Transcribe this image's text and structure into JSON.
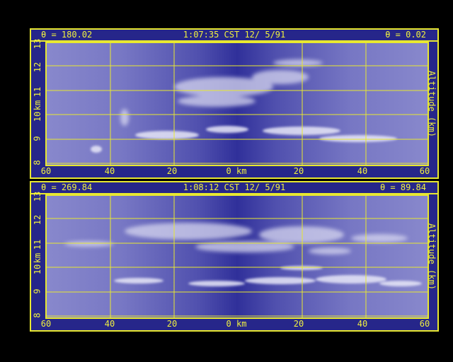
{
  "colors": {
    "background": "#000000",
    "frame": "#e8e830",
    "label_text": "#f0f040",
    "panel_fill": "#26268a",
    "grid": "#e8e830"
  },
  "y_axis": {
    "ticks": [
      "8",
      "9",
      "10",
      "11",
      "12",
      "13"
    ],
    "unit_label": "km",
    "title": "Altitude (km)"
  },
  "x_axis": {
    "ticks": [
      "60",
      "40",
      "20",
      "0 km",
      "20",
      "40",
      "60"
    ]
  },
  "panels": [
    {
      "theta_left": "θ = 180.02",
      "timestamp": "1:07:35 CST 12/ 5/91",
      "theta_right": "θ = 0.02"
    },
    {
      "theta_left": "θ = 269.84",
      "timestamp": "1:08:12 CST 12/ 5/91",
      "theta_right": "θ = 89.84"
    }
  ]
}
